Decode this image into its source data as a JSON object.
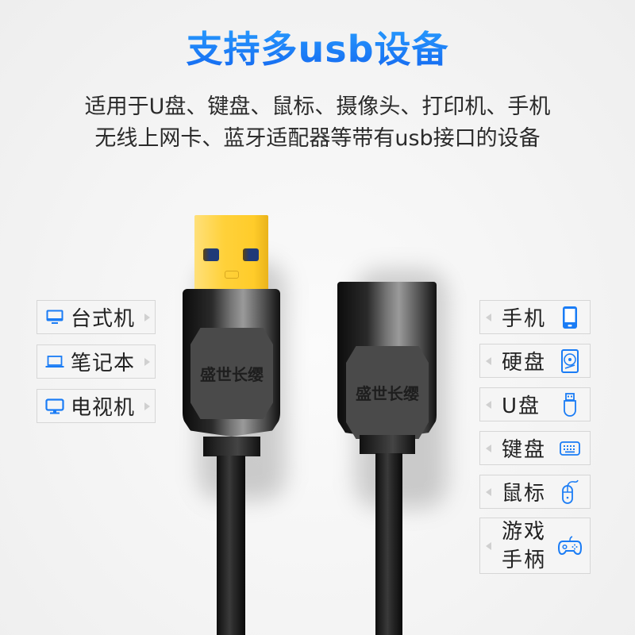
{
  "header": {
    "title": "支持多usb设备",
    "subtitle_line1": "适用于U盘、键盘、鼠标、摄像头、打印机、手机",
    "subtitle_line2": "无线上网卡、蓝牙适配器等带有usb接口的设备"
  },
  "brand_text": "盛世长缨",
  "colors": {
    "accent": "#1a7cf5",
    "plug_gold": "#ffd13a",
    "cable": "#1a1a1a"
  },
  "left_devices": [
    {
      "label": "台式机",
      "icon": "desktop-monitor-icon"
    },
    {
      "label": "笔记本",
      "icon": "laptop-icon"
    },
    {
      "label": "电视机",
      "icon": "tv-icon"
    }
  ],
  "right_devices": [
    {
      "label": "手机",
      "icon": "phone-icon"
    },
    {
      "label": "硬盘",
      "icon": "hard-disk-icon"
    },
    {
      "label": "U盘",
      "icon": "usb-drive-icon"
    },
    {
      "label": "键盘",
      "icon": "keyboard-icon"
    },
    {
      "label": "鼠标",
      "icon": "mouse-icon"
    },
    {
      "label_line1": "游戏",
      "label_line2": "手柄",
      "icon": "gamepad-icon"
    }
  ]
}
